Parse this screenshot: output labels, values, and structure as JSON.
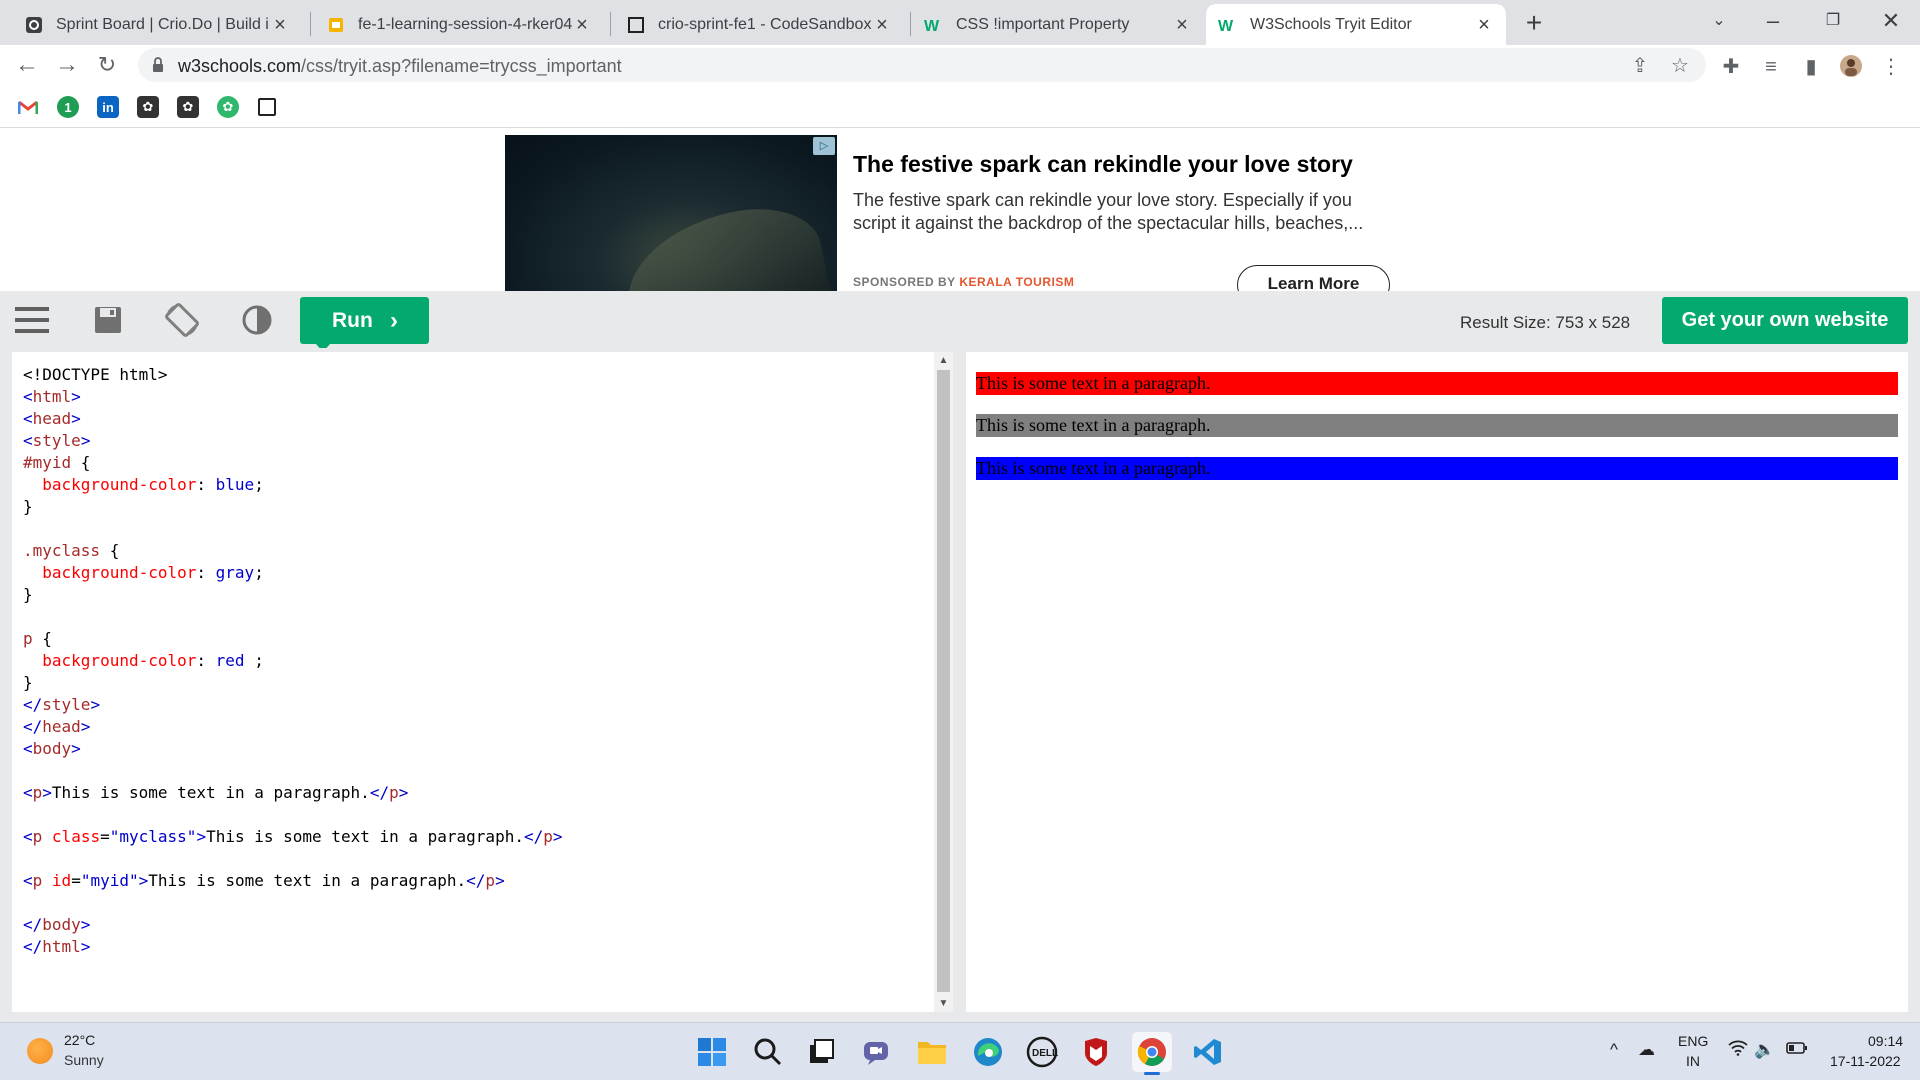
{
  "browser": {
    "tabs": [
      {
        "title": "Sprint Board | Crio.Do | Build inte",
        "icon": "crio-icon"
      },
      {
        "title": "fe-1-learning-session-4-rker04 - ",
        "icon": "slides-icon"
      },
      {
        "title": "crio-sprint-fe1 - CodeSandbox",
        "icon": "codesandbox-icon"
      },
      {
        "title": "CSS !important Property",
        "icon": "w3schools-icon"
      },
      {
        "title": "W3Schools Tryit Editor",
        "icon": "w3schools-icon"
      }
    ],
    "url_domain": "w3schools.com",
    "url_path": "/css/tryit.asp?filename=trycss_important"
  },
  "ad": {
    "title": "The festive spark can rekindle your love story",
    "description": "The festive spark can rekindle your love story. Especially if you script it against the backdrop of the spectacular hills, beaches,...",
    "sponsored_label": "SPONSORED BY",
    "sponsor": "KERALA TOURISM",
    "cta": "Learn More"
  },
  "editor": {
    "run_label": "Run",
    "result_size": "Result Size: 753 x 528",
    "get_website_label": "Get your own website"
  },
  "result": {
    "paragraphs": [
      {
        "text": "This is some text in a paragraph.",
        "bg": "#ff0000"
      },
      {
        "text": "This is some text in a paragraph.",
        "bg": "#808080"
      },
      {
        "text": "This is some text in a paragraph.",
        "bg": "#0000ff"
      }
    ]
  },
  "taskbar": {
    "temperature": "22°C",
    "condition": "Sunny",
    "lang_line1": "ENG",
    "lang_line2": "IN",
    "time": "09:14",
    "date": "17-11-2022"
  },
  "colors": {
    "accent_green": "#04aa6d",
    "toolbar_bg": "#e7e9eb"
  }
}
